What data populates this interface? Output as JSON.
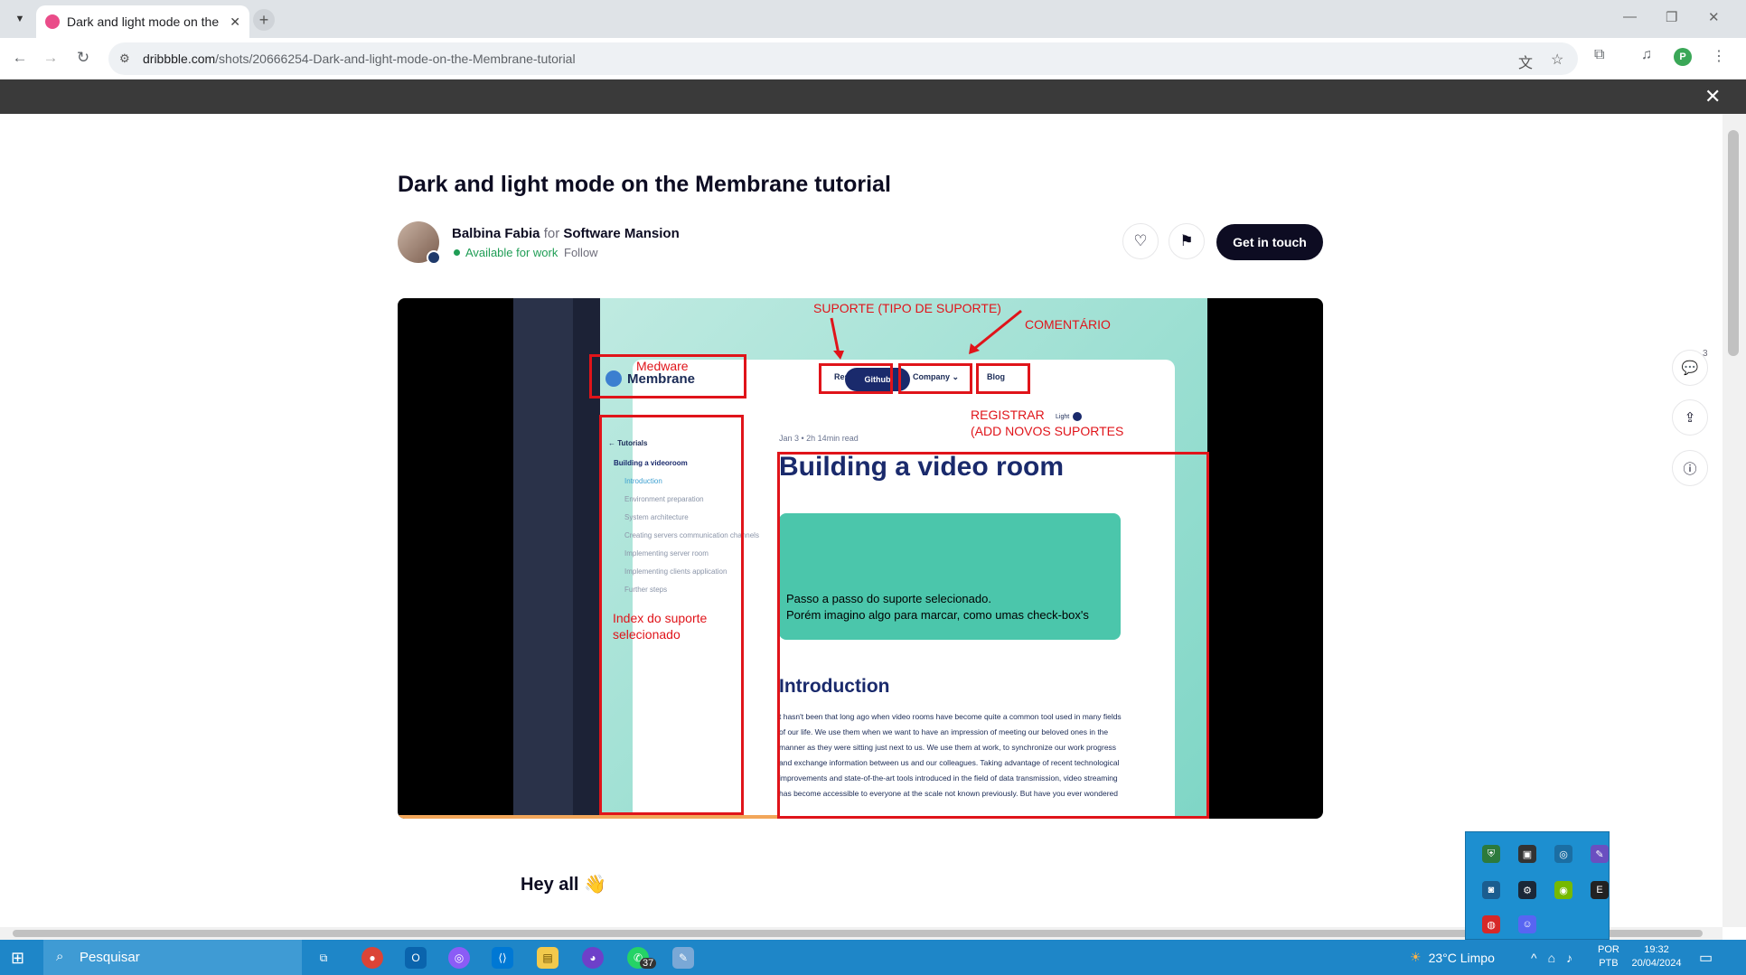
{
  "browser": {
    "tab_title": "Dark and light mode on the Membrane tutorial",
    "url_host": "dribbble.com",
    "url_path": "/shots/20666254-Dark-and-light-mode-on-the-Membrane-tutorial",
    "profile_initial": "P"
  },
  "shot": {
    "title": "Dark and light mode on the Membrane tutorial",
    "author": "Balbina Fabia",
    "for_word": "for",
    "team": "Software Mansion",
    "availability": "Available for work",
    "follow": "Follow",
    "get_in_touch": "Get in touch",
    "comment_count": "3",
    "section_heading": "Hey all 👋"
  },
  "mockup": {
    "logo": "Membrane",
    "nav": [
      "Resources ⌄",
      "Company ⌄",
      "Blog"
    ],
    "github": "Github",
    "light_toggle": "Light",
    "back_link": "← Tutorials",
    "sidebar_title": "Building a videoroom",
    "sidebar_items": [
      "Introduction",
      "Environment preparation",
      "System architecture",
      "Creating servers communication channels",
      "Implementing server room",
      "Implementing clients application",
      "Further steps"
    ],
    "date": "Jan 3 • 2h 14min read",
    "heading": "Building a video room",
    "intro_heading": "Introduction",
    "body_text": "t hasn't been that long ago when video rooms have become quite a common tool used in many fields of our life. We use them when we want to have an impression of meeting our beloved ones in the manner as they were sitting just next to us. We use them at work, to synchronize our work progress and exchange information between us and our colleagues. Taking advantage of recent technological improvements and state-of-the-art tools introduced in the field of data transmission, video streaming has become accessible to everyone at the scale not known previously. But have you ever wondered"
  },
  "annotations": {
    "suporte": "SUPORTE (TIPO DE SUPORTE)",
    "comentario": "COMENTÁRIO",
    "medware": "Medware",
    "registrar_1": "REGISTRAR",
    "registrar_2": "(ADD NOVOS SUPORTES",
    "index_1": "Index do suporte",
    "index_2": "selecionado",
    "passo_1": "Passo a passo do suporte selecionado.",
    "passo_2": "Porém imagino algo para marcar, como umas check-box's"
  },
  "taskbar": {
    "search_placeholder": "Pesquisar",
    "whatsapp_badge": "37",
    "weather": "23°C  Limpo",
    "lang_1": "POR",
    "lang_2": "PTB",
    "time": "19:32",
    "date": "20/04/2024"
  },
  "colors": {
    "annotation_red": "#e0141a",
    "brand_dark": "#0d0c22",
    "taskbar": "#1e86c8"
  }
}
